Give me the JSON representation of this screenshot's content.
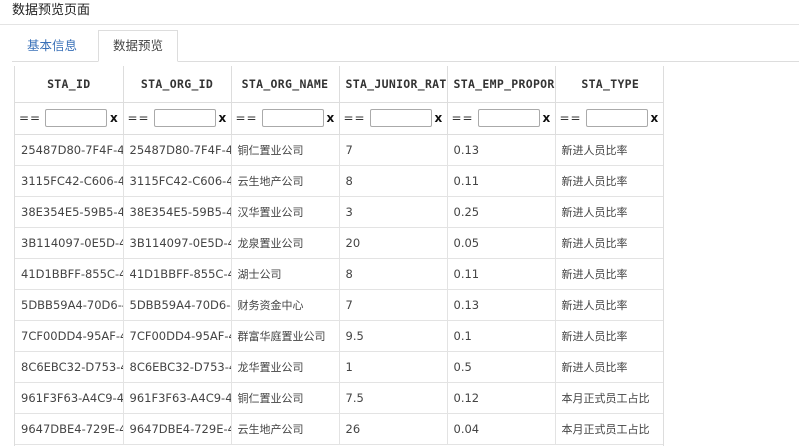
{
  "page": {
    "title": "数据预览页面"
  },
  "tabs": [
    {
      "label": "基本信息",
      "active": false
    },
    {
      "label": "数据预览",
      "active": true
    }
  ],
  "colors": {
    "tab_link": "#3a71b8",
    "border": "#dddddd"
  },
  "grid": {
    "columns": [
      "STA_ID",
      "STA_ORG_ID",
      "STA_ORG_NAME",
      "STA_JUNIOR_RATE",
      "STA_EMP_PROPORTION",
      "STA_TYPE"
    ],
    "filter": {
      "operator": "==",
      "value": "",
      "clear_label": "x"
    },
    "rows": [
      [
        "25487D80-7F4F-4",
        "25487D80-7F4F-4",
        "铜仁置业公司",
        "7",
        "0.13",
        "新进人员比率"
      ],
      [
        "3115FC42-C606-4",
        "3115FC42-C606-4",
        "云生地产公司",
        "8",
        "0.11",
        "新进人员比率"
      ],
      [
        "38E354E5-59B5-4",
        "38E354E5-59B5-4",
        "汉华置业公司",
        "3",
        "0.25",
        "新进人员比率"
      ],
      [
        "3B114097-0E5D-4",
        "3B114097-0E5D-4",
        "龙泉置业公司",
        "20",
        "0.05",
        "新进人员比率"
      ],
      [
        "41D1BBFF-855C-4",
        "41D1BBFF-855C-4",
        "湖士公司",
        "8",
        "0.11",
        "新进人员比率"
      ],
      [
        "5DBB59A4-70D6-4",
        "5DBB59A4-70D6-4",
        "财务资金中心",
        "7",
        "0.13",
        "新进人员比率"
      ],
      [
        "7CF00DD4-95AF-4",
        "7CF00DD4-95AF-4",
        "群富华庭置业公司",
        "9.5",
        "0.1",
        "新进人员比率"
      ],
      [
        "8C6EBC32-D753-4",
        "8C6EBC32-D753-4",
        "龙华置业公司",
        "1",
        "0.5",
        "新进人员比率"
      ],
      [
        "961F3F63-A4C9-4",
        "961F3F63-A4C9-4",
        "铜仁置业公司",
        "7.5",
        "0.12",
        "本月正式员工占比"
      ],
      [
        "9647DBE4-729E-4",
        "9647DBE4-729E-4",
        "云生地产公司",
        "26",
        "0.04",
        "本月正式员工占比"
      ]
    ]
  }
}
